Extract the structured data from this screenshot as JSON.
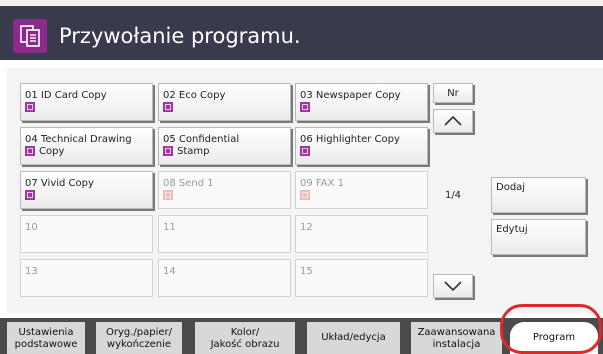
{
  "header": {
    "title": "Przywołanie programu.",
    "icon": "program-recall-icon"
  },
  "programs": [
    {
      "num": "01",
      "label": "ID Card Copy",
      "state": "enabled"
    },
    {
      "num": "02",
      "label": "Eco Copy",
      "state": "enabled"
    },
    {
      "num": "03",
      "label": "Newspaper Copy",
      "state": "enabled"
    },
    {
      "num": "04",
      "label": "Technical Drawing Copy",
      "line1": "Technical Drawing",
      "line2": "Copy",
      "state": "enabled"
    },
    {
      "num": "05",
      "label": "Confidential Stamp",
      "line1": "Confidential",
      "line2": "Stamp",
      "state": "enabled"
    },
    {
      "num": "06",
      "label": "Highlighter Copy",
      "state": "enabled"
    },
    {
      "num": "07",
      "label": "Vivid Copy",
      "state": "enabled"
    },
    {
      "num": "08",
      "label": "Send 1",
      "state": "disabled"
    },
    {
      "num": "09",
      "label": "FAX 1",
      "state": "disabled"
    },
    {
      "num": "10",
      "label": "",
      "state": "empty"
    },
    {
      "num": "11",
      "label": "",
      "state": "empty"
    },
    {
      "num": "12",
      "label": "",
      "state": "empty"
    },
    {
      "num": "13",
      "label": "",
      "state": "empty"
    },
    {
      "num": "14",
      "label": "",
      "state": "empty"
    },
    {
      "num": "15",
      "label": "",
      "state": "empty"
    }
  ],
  "pager": {
    "nr_label": "Nr",
    "page": "1/4"
  },
  "side": {
    "add": "Dodaj",
    "edit": "Edytuj"
  },
  "tabs": [
    {
      "line1": "Ustawienia",
      "line2": "podstawowe"
    },
    {
      "line1": "Oryg./papier/",
      "line2": "wykończenie"
    },
    {
      "line1": "Kolor/",
      "line2": "Jakość obrazu"
    },
    {
      "line1": "Układ/edycja",
      "line2": ""
    },
    {
      "line1": "Zaawansowana",
      "line2": "instalacja"
    },
    {
      "line1": "Program",
      "line2": "",
      "active": true
    }
  ],
  "colors": {
    "titlebar": "#3a3a4d",
    "program_icon": "#a135a1",
    "highlight": "#e02828"
  }
}
